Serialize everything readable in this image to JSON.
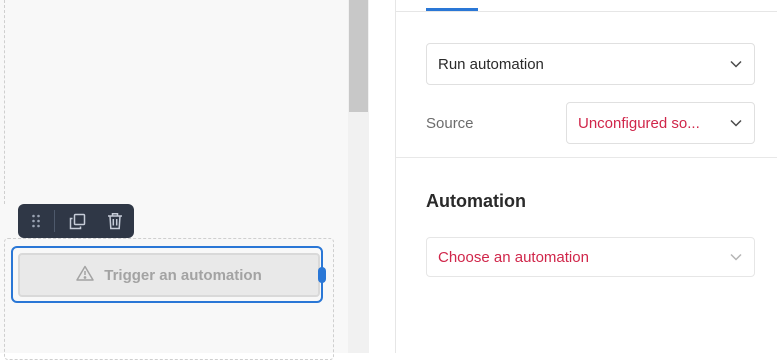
{
  "canvas": {
    "toolbar": {
      "drag_icon": "drag-handle-icon",
      "duplicate_icon": "duplicate-icon",
      "delete_icon": "trash-icon"
    },
    "trigger_button": {
      "label": "Trigger an automation",
      "icon": "warning-icon"
    }
  },
  "panel": {
    "action_select": {
      "value": "Run automation"
    },
    "source": {
      "label": "Source",
      "value": "Unconfigured so..."
    },
    "automation_section": {
      "title": "Automation",
      "select_placeholder": "Choose an automation"
    }
  },
  "colors": {
    "accent": "#2a77d6",
    "error_text": "#d0264a",
    "toolbar_bg": "#2f3746"
  }
}
